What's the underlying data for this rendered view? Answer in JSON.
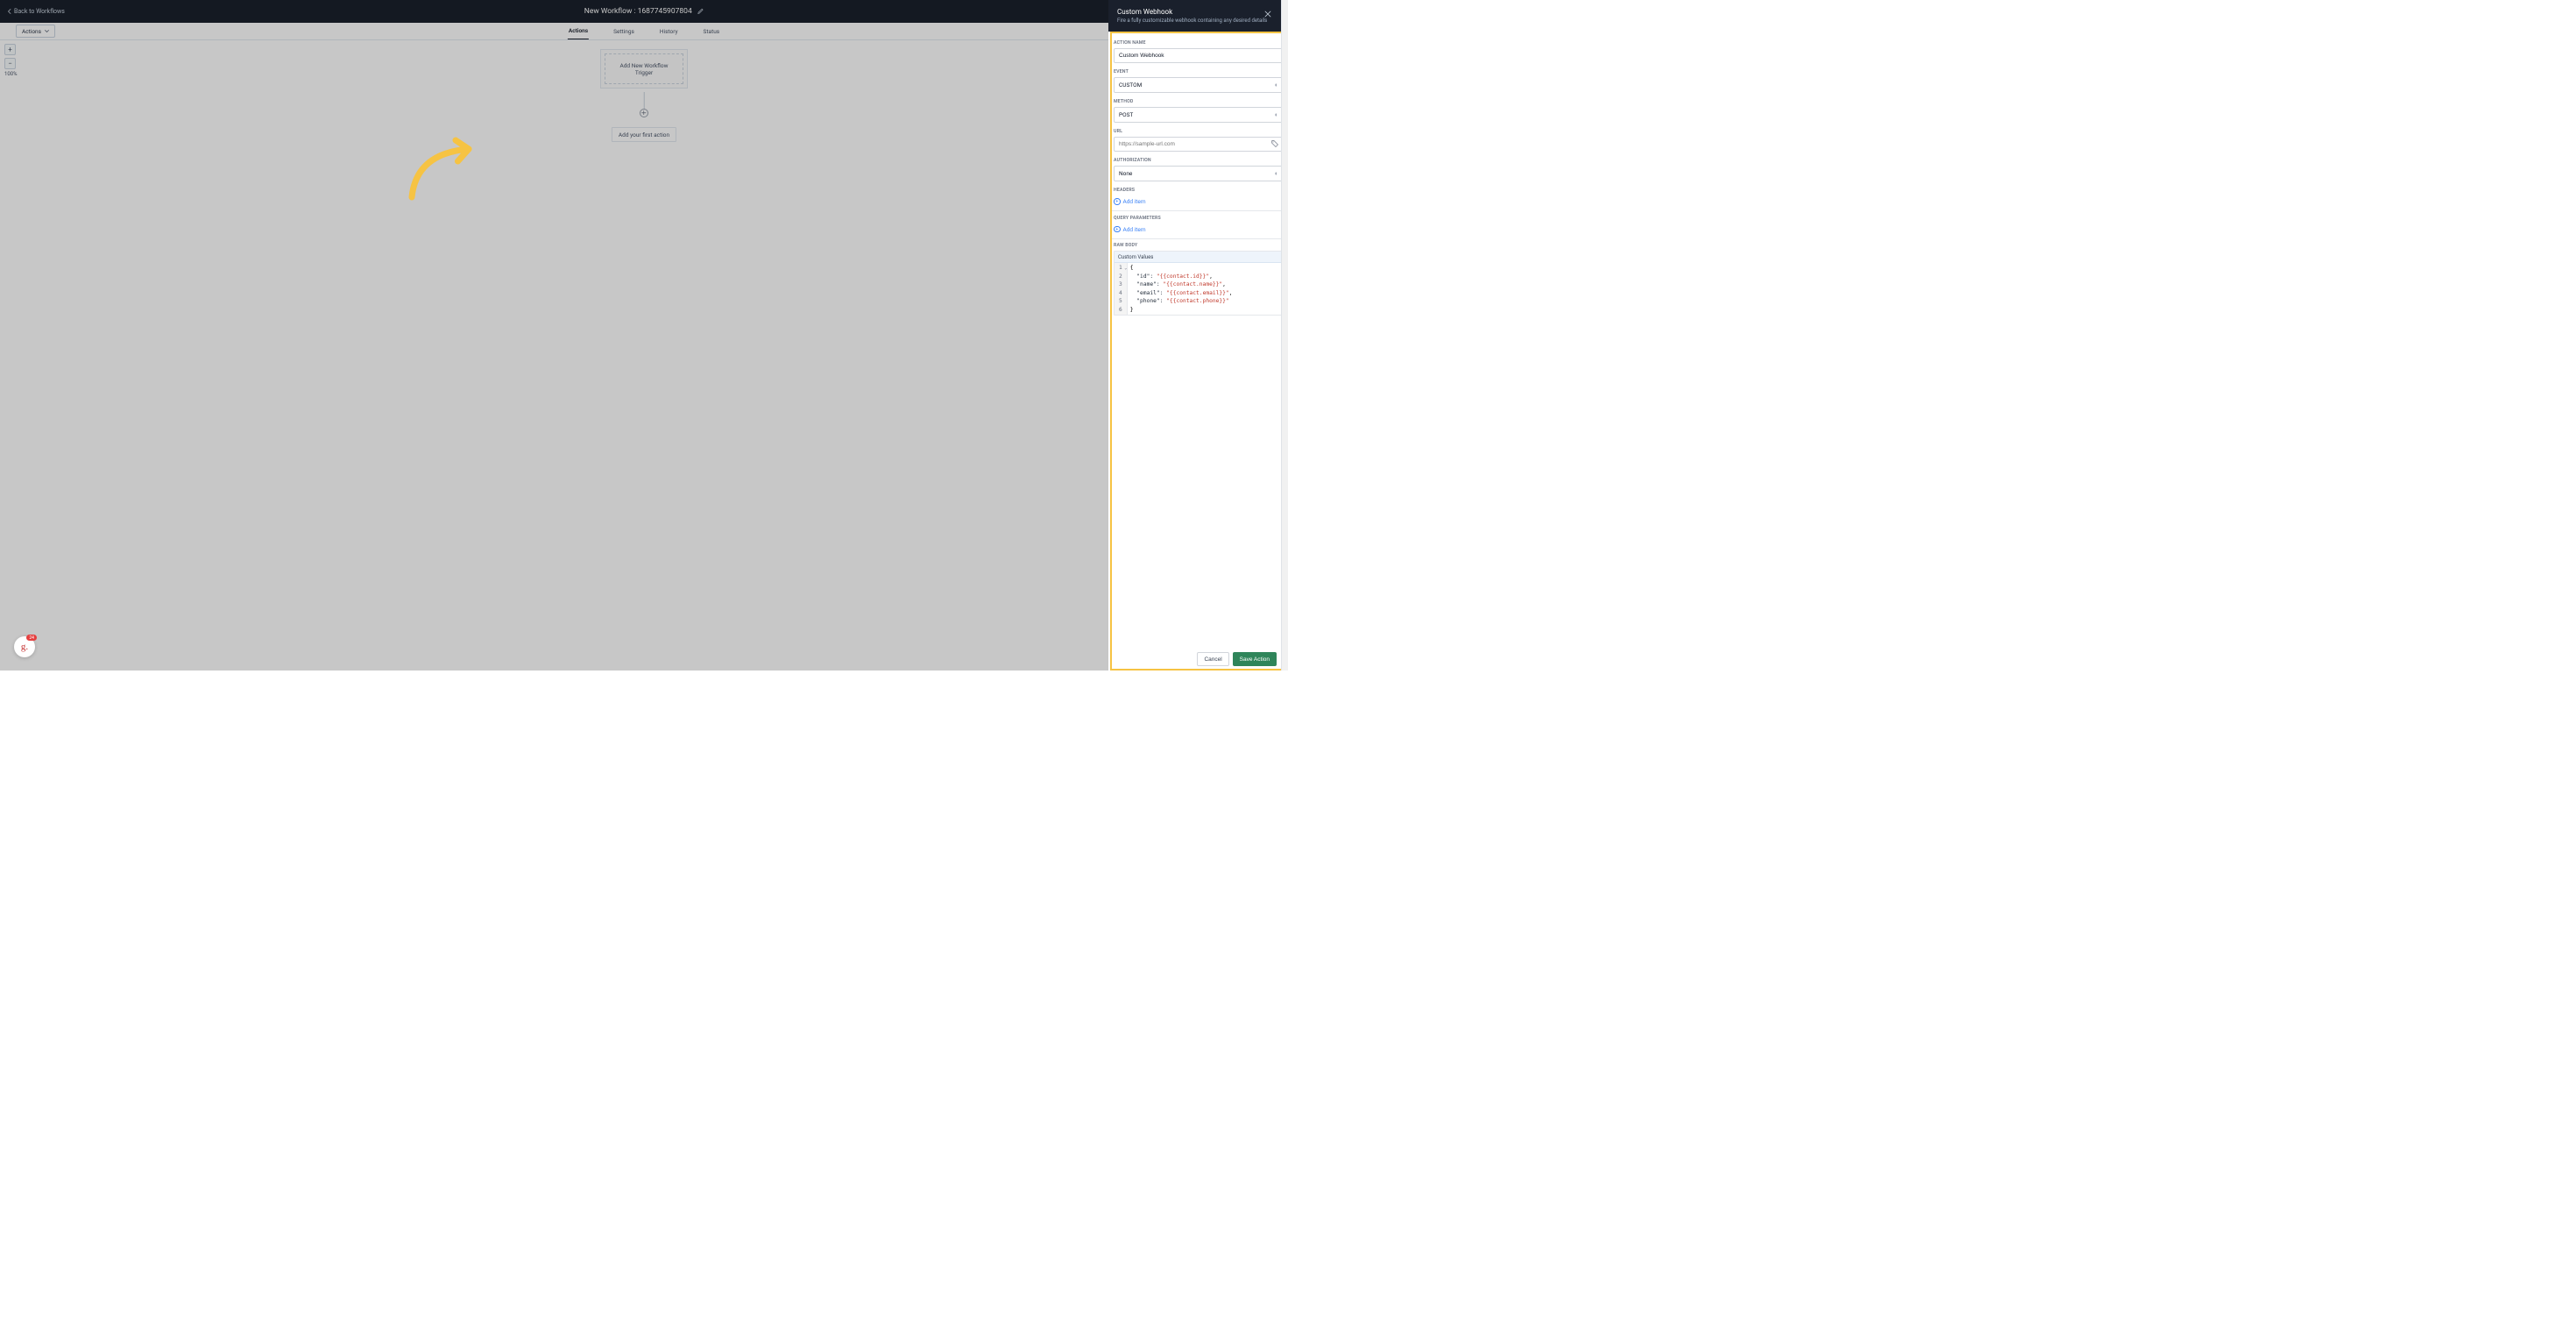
{
  "header": {
    "back_label": "Back to Workflows",
    "title": "New Workflow : 1687745907804"
  },
  "tabs": {
    "actions_dropdown": "Actions",
    "items": [
      "Actions",
      "Settings",
      "History",
      "Status"
    ],
    "active_index": 0
  },
  "zoom": {
    "percent": "100%"
  },
  "canvas": {
    "trigger_label": "Add New Workflow Trigger",
    "first_action_label": "Add your first action"
  },
  "drawer": {
    "title": "Custom Webhook",
    "subtitle": "Fire a fully customizable webhook containing any desired details",
    "fields": {
      "action_name": {
        "label": "ACTION NAME",
        "value": "Custom Webhook"
      },
      "event": {
        "label": "EVENT",
        "value": "CUSTOM"
      },
      "method": {
        "label": "METHOD",
        "value": "POST"
      },
      "url": {
        "label": "URL",
        "placeholder": "https://sample-url.com"
      },
      "authorization": {
        "label": "AUTHORIZATION",
        "value": "None"
      },
      "headers": {
        "label": "HEADERS",
        "add_label": "Add item"
      },
      "query_params": {
        "label": "QUERY PARAMETERS",
        "add_label": "Add item"
      },
      "raw_body": {
        "label": "RAW BODY",
        "custom_values_label": "Custom Values"
      }
    },
    "code": {
      "lines": [
        "1",
        "2",
        "3",
        "4",
        "5",
        "6"
      ],
      "l1": "{",
      "l2_key": "\"id\": ",
      "l2_val": "\"{{contact.id}}\"",
      "l3_key": "\"name\": ",
      "l3_val": "\"{{contact.name}}\"",
      "l4_key": "\"email\": ",
      "l4_val": "\"{{contact.email}}\"",
      "l5_key": "\"phone\": ",
      "l5_val": "\"{{contact.phone}}\"",
      "l6": "}"
    },
    "footer": {
      "cancel": "Cancel",
      "save": "Save Action"
    }
  },
  "badge": {
    "letter": "g.",
    "count": "24"
  }
}
